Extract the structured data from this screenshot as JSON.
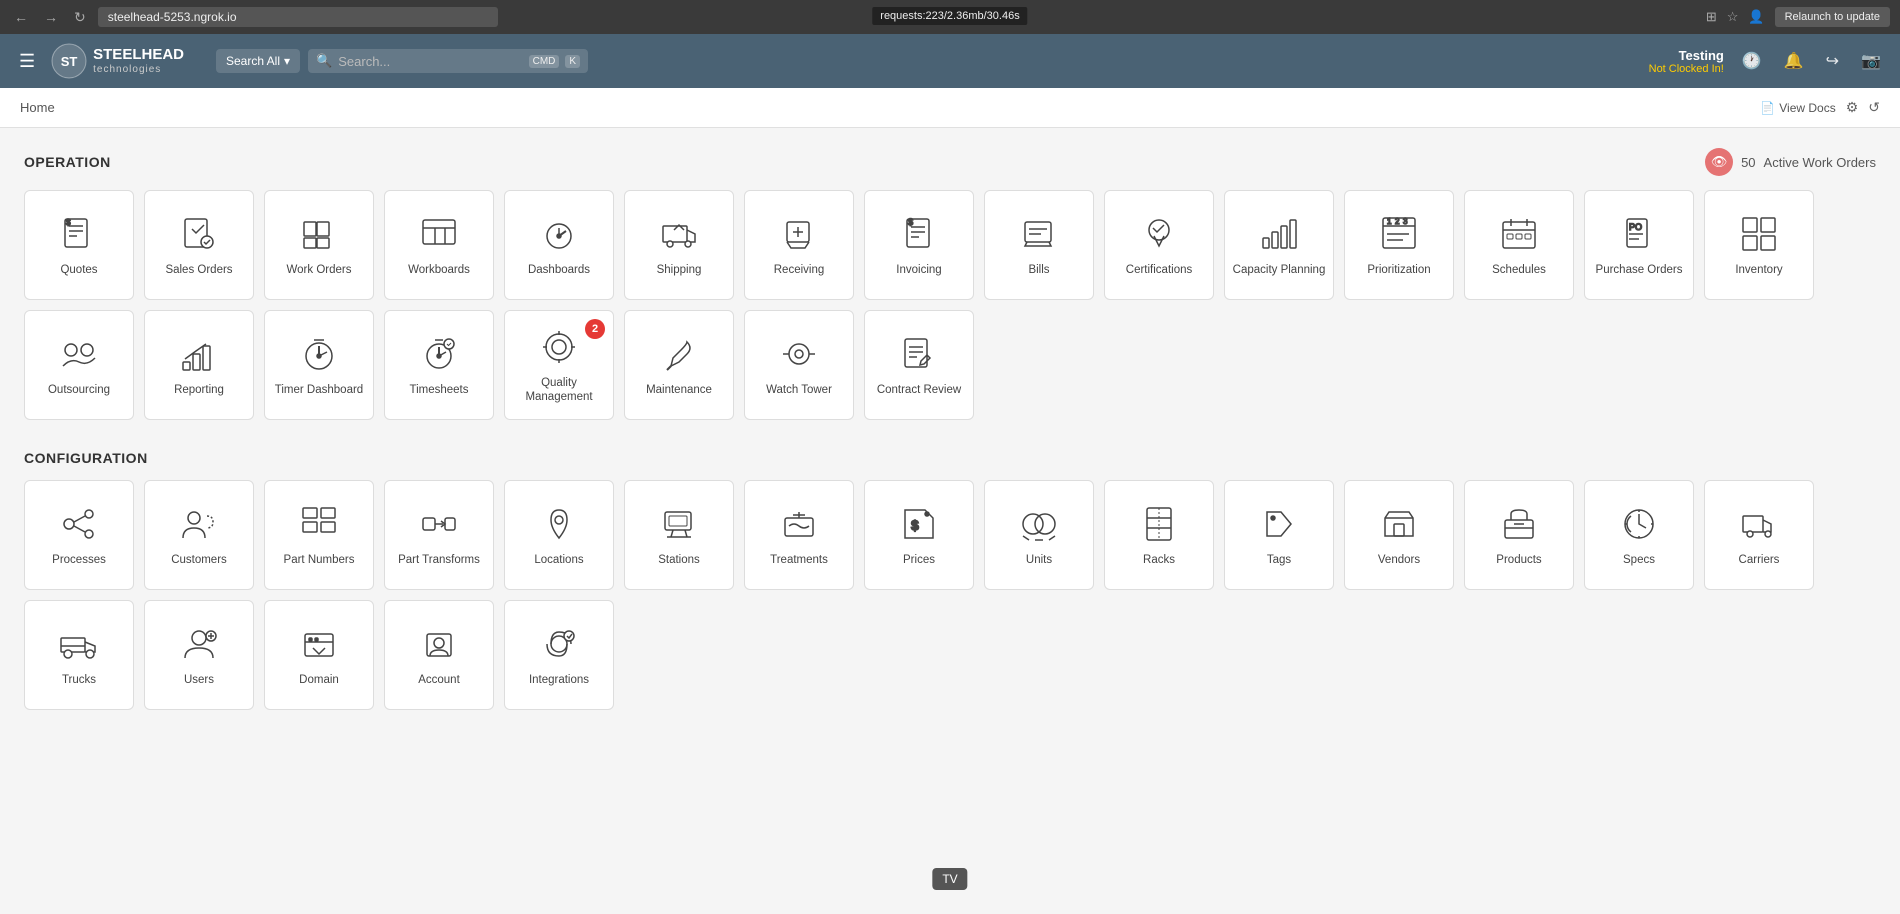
{
  "browser": {
    "url": "steelhead-5253.ngrok.io",
    "ngrok_banner": "requests:223/2.36mb/30.46s",
    "relaunch_label": "Relaunch to update"
  },
  "header": {
    "menu_icon": "☰",
    "logo_name": "STEELHEAD",
    "logo_sub": "technologies",
    "search_all_label": "Search All",
    "search_placeholder": "Search...",
    "user_name": "Testing",
    "user_status": "Not Clocked In!",
    "kbd1": "CMD",
    "kbd2": "K"
  },
  "breadcrumb": {
    "home_label": "Home",
    "view_docs_label": "View Docs"
  },
  "operation": {
    "section_title": "OPERATION",
    "active_wo_count": "50",
    "active_wo_label": "Active Work Orders",
    "cards": [
      {
        "id": "quotes",
        "label": "Quotes"
      },
      {
        "id": "sales-orders",
        "label": "Sales Orders"
      },
      {
        "id": "work-orders",
        "label": "Work Orders"
      },
      {
        "id": "workboards",
        "label": "Workboards"
      },
      {
        "id": "dashboards",
        "label": "Dashboards"
      },
      {
        "id": "shipping",
        "label": "Shipping"
      },
      {
        "id": "receiving",
        "label": "Receiving"
      },
      {
        "id": "invoicing",
        "label": "Invoicing"
      },
      {
        "id": "bills",
        "label": "Bills"
      },
      {
        "id": "certifications",
        "label": "Certifications"
      },
      {
        "id": "capacity-planning",
        "label": "Capacity Planning"
      },
      {
        "id": "prioritization",
        "label": "Prioritization"
      },
      {
        "id": "schedules",
        "label": "Schedules"
      },
      {
        "id": "purchase-orders",
        "label": "Purchase Orders"
      },
      {
        "id": "inventory",
        "label": "Inventory"
      },
      {
        "id": "outsourcing",
        "label": "Outsourcing"
      },
      {
        "id": "reporting",
        "label": "Reporting"
      },
      {
        "id": "timer-dashboard",
        "label": "Timer Dashboard"
      },
      {
        "id": "timesheets",
        "label": "Timesheets"
      },
      {
        "id": "quality-management",
        "label": "Quality Management",
        "badge": "2"
      },
      {
        "id": "maintenance",
        "label": "Maintenance"
      },
      {
        "id": "watch-tower",
        "label": "Watch Tower"
      },
      {
        "id": "contract-review",
        "label": "Contract Review"
      }
    ]
  },
  "configuration": {
    "section_title": "CONFIGURATION",
    "cards": [
      {
        "id": "processes",
        "label": "Processes"
      },
      {
        "id": "customers",
        "label": "Customers"
      },
      {
        "id": "part-numbers",
        "label": "Part Numbers"
      },
      {
        "id": "part-transforms",
        "label": "Part Transforms"
      },
      {
        "id": "locations",
        "label": "Locations"
      },
      {
        "id": "stations",
        "label": "Stations"
      },
      {
        "id": "treatments",
        "label": "Treatments"
      },
      {
        "id": "prices",
        "label": "Prices"
      },
      {
        "id": "units",
        "label": "Units"
      },
      {
        "id": "racks",
        "label": "Racks"
      },
      {
        "id": "tags",
        "label": "Tags"
      },
      {
        "id": "vendors",
        "label": "Vendors"
      },
      {
        "id": "products",
        "label": "Products"
      },
      {
        "id": "specs",
        "label": "Specs"
      },
      {
        "id": "carriers",
        "label": "Carriers"
      },
      {
        "id": "trucks",
        "label": "Trucks"
      },
      {
        "id": "users",
        "label": "Users"
      },
      {
        "id": "domain",
        "label": "Domain"
      },
      {
        "id": "account",
        "label": "Account"
      },
      {
        "id": "integrations",
        "label": "Integrations"
      }
    ]
  },
  "tooltip": {
    "label": "TV"
  }
}
